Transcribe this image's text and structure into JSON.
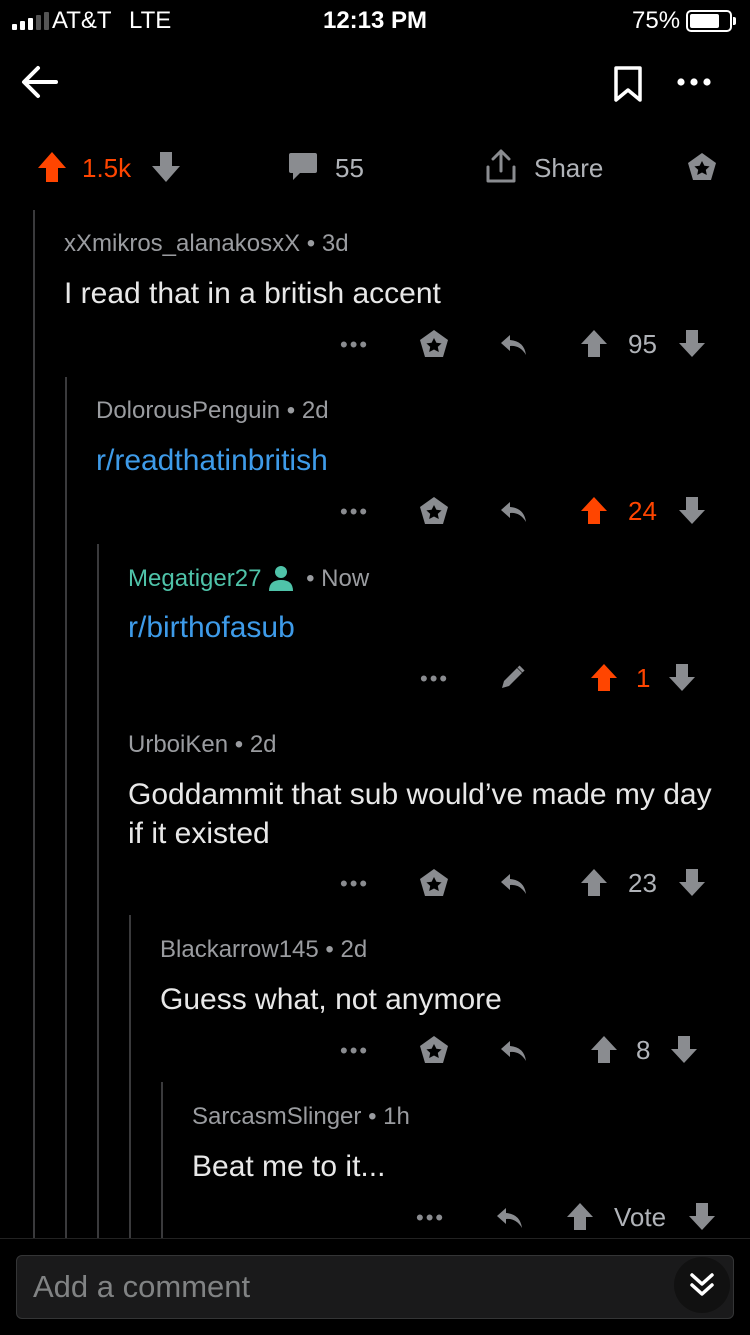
{
  "status_bar": {
    "carrier": "AT&T",
    "network": "LTE",
    "time": "12:13 PM",
    "battery": "75%",
    "battery_level": 0.75
  },
  "post_bar": {
    "upvotes": "1.5k",
    "comments": "55",
    "share_label": "Share",
    "upvoted": true
  },
  "comments": [
    {
      "author": "xXmikros_alanakosxX",
      "age": "3d",
      "text": "I read that in a british accent",
      "votes": "95",
      "upvoted": false
    },
    {
      "author": "DolorousPenguin",
      "age": "2d",
      "text": "r/readthatinbritish",
      "votes": "24",
      "upvoted": true
    },
    {
      "author": "Megatiger27",
      "age": "Now",
      "text": "r/birthofasub",
      "votes": "1",
      "upvoted": true
    },
    {
      "author": "UrboiKen",
      "age": "2d",
      "text": "Goddammit that sub would’ve made my day if it existed",
      "votes": "23",
      "upvoted": false
    },
    {
      "author": "Blackarrow145",
      "age": "2d",
      "text": "Guess what, not anymore",
      "votes": "8",
      "upvoted": false
    },
    {
      "author": "SarcasmSlinger",
      "age": "1h",
      "text": "Beat me to it...",
      "votes": "Vote",
      "upvoted": false
    }
  ],
  "comment_input": {
    "placeholder": "Add a comment"
  },
  "colors": {
    "accent": "#ff4500",
    "link": "#3e9be9",
    "self": "#4fc3a9",
    "text": "#e8e8e8",
    "muted": "#9a9ca0"
  },
  "ui": {
    "separator": "•",
    "more_glyph": "•••"
  }
}
